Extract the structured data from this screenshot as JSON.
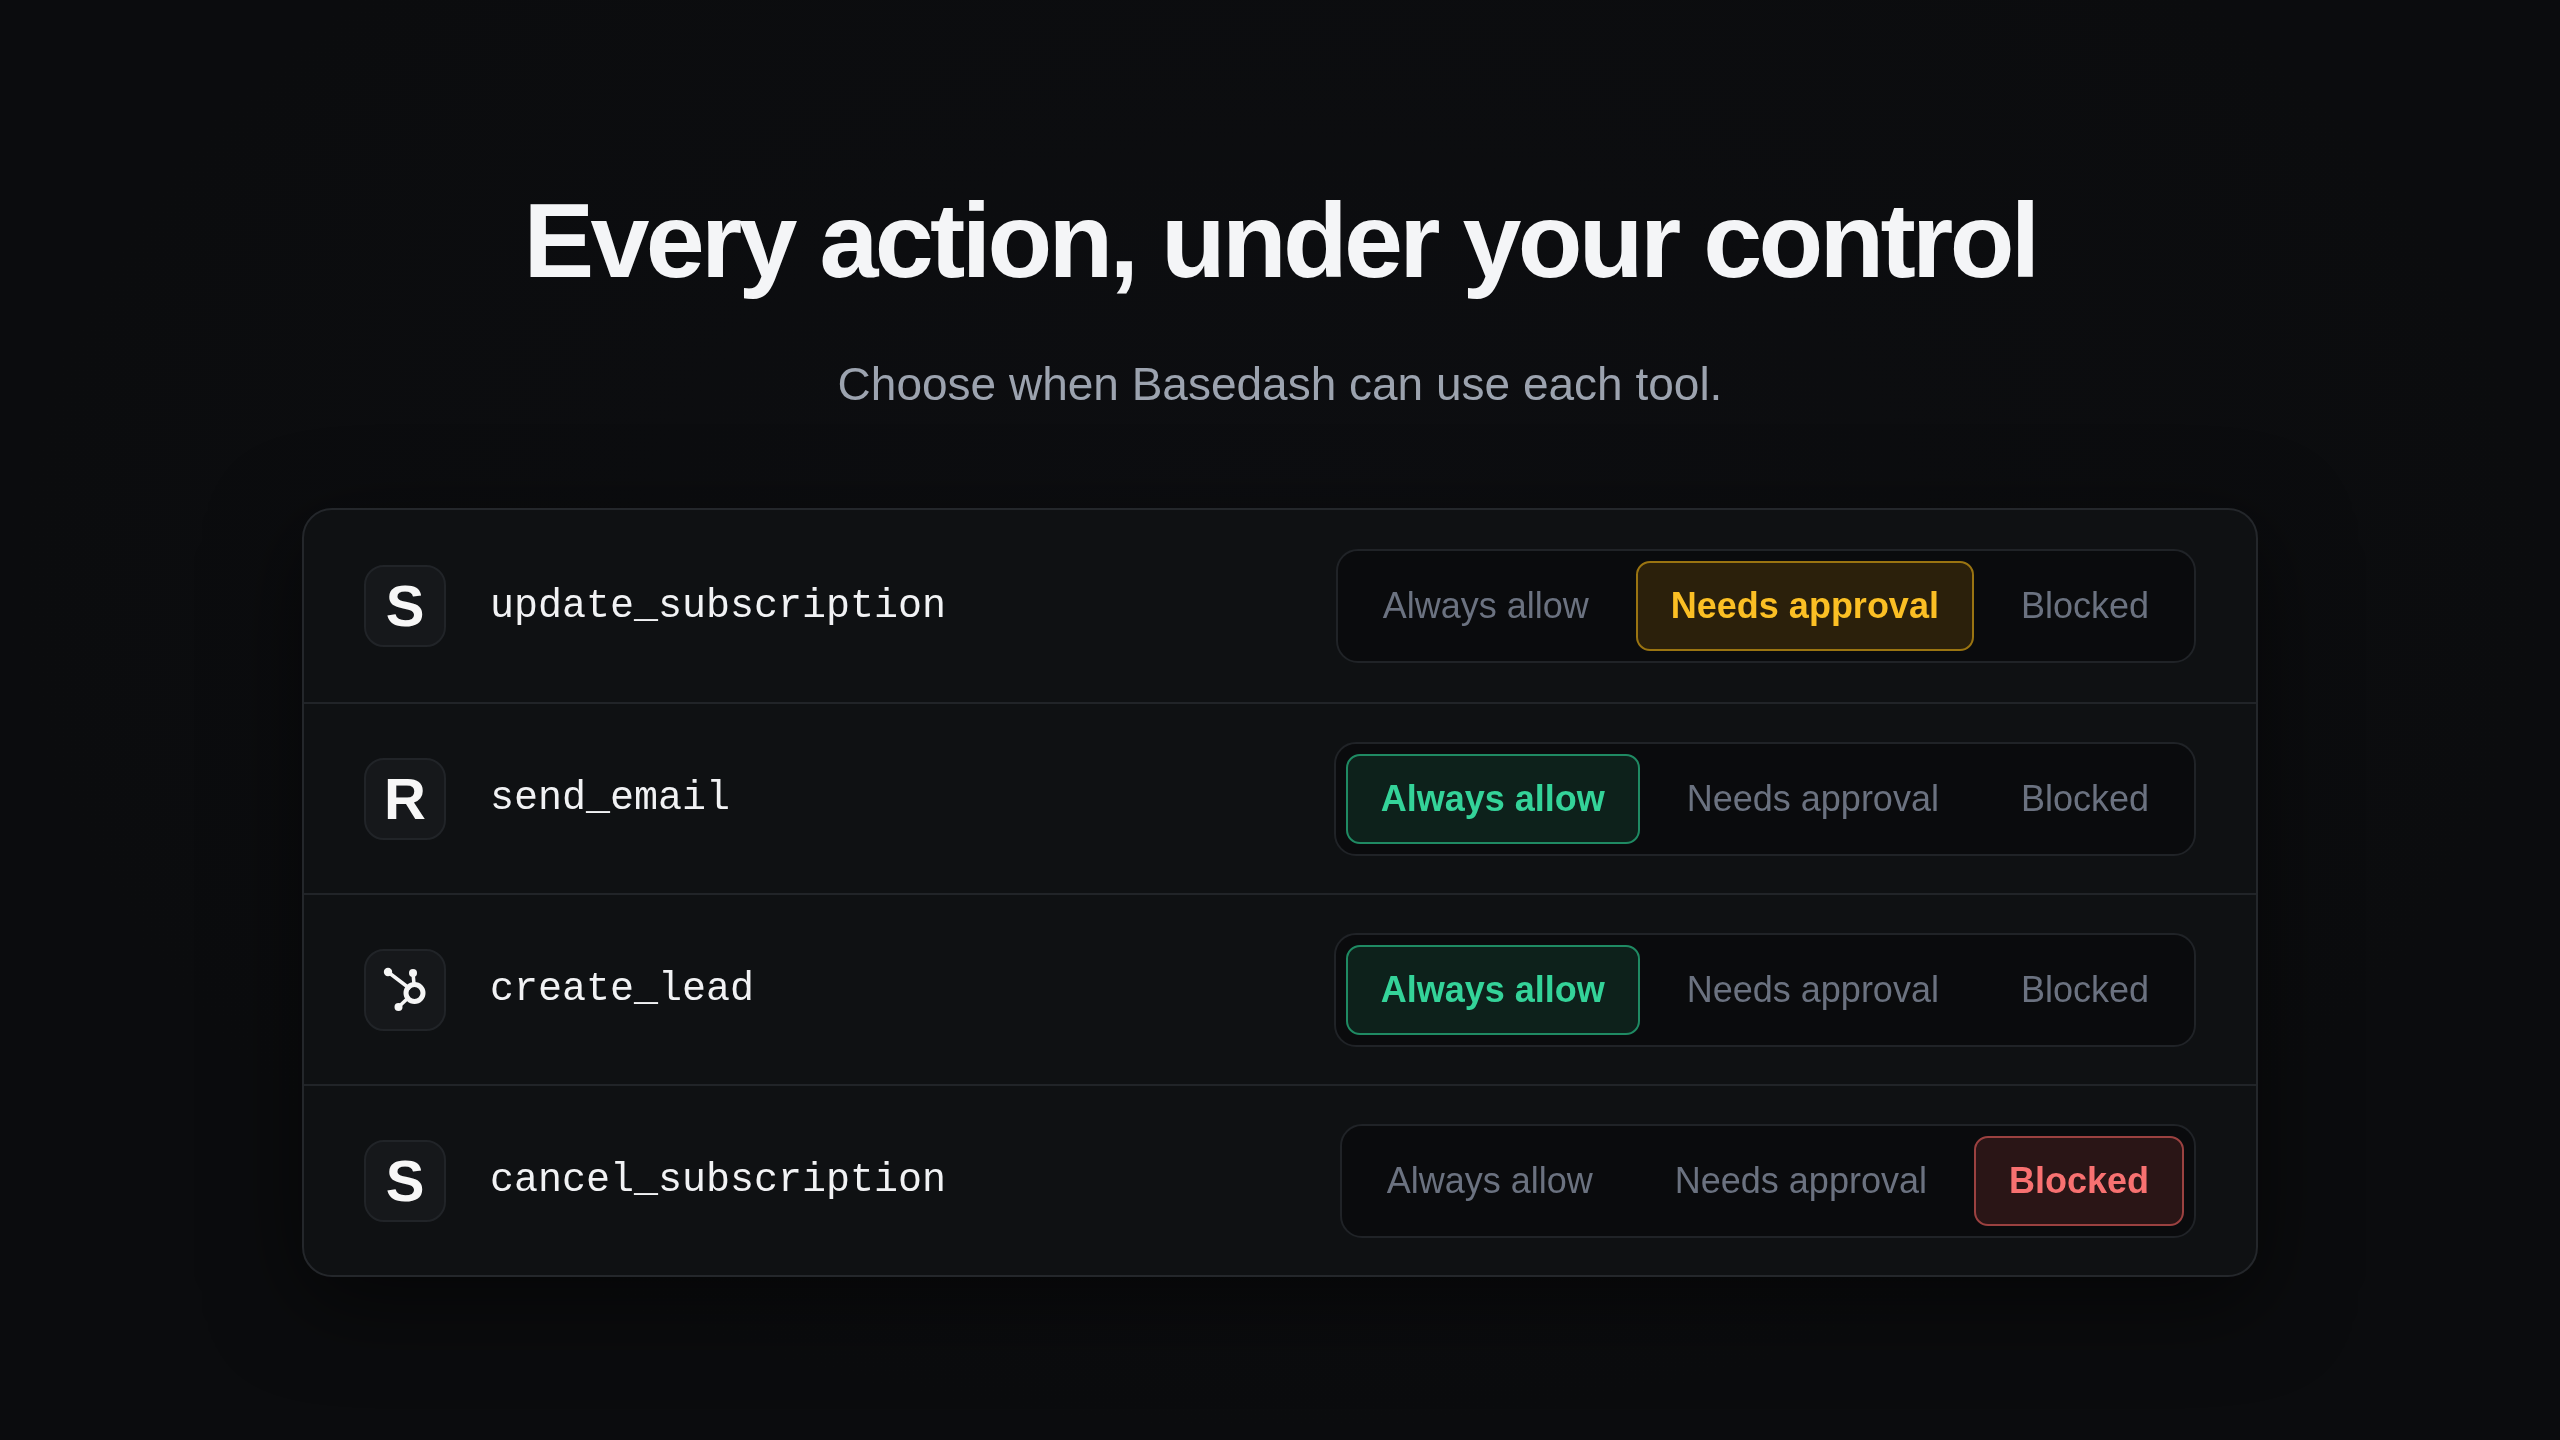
{
  "heading": {
    "title": "Every action, under your control",
    "subtitle": "Choose when Basedash can use each tool."
  },
  "tools": [
    {
      "name": "update_subscription",
      "icon": {
        "kind": "letter",
        "text": "S"
      },
      "options": [
        {
          "label": "Always allow",
          "kind": "allow",
          "selected": false
        },
        {
          "label": "Needs approval",
          "kind": "approval",
          "selected": true
        },
        {
          "label": "Blocked",
          "kind": "blocked",
          "selected": false
        }
      ]
    },
    {
      "name": "send_email",
      "icon": {
        "kind": "letter",
        "text": "R"
      },
      "options": [
        {
          "label": "Always allow",
          "kind": "allow",
          "selected": true
        },
        {
          "label": "Needs approval",
          "kind": "approval",
          "selected": false
        },
        {
          "label": "Blocked",
          "kind": "blocked",
          "selected": false
        }
      ]
    },
    {
      "name": "create_lead",
      "icon": {
        "kind": "hub"
      },
      "options": [
        {
          "label": "Always allow",
          "kind": "allow",
          "selected": true
        },
        {
          "label": "Needs approval",
          "kind": "approval",
          "selected": false
        },
        {
          "label": "Blocked",
          "kind": "blocked",
          "selected": false
        }
      ]
    },
    {
      "name": "cancel_subscription",
      "icon": {
        "kind": "letter",
        "text": "S"
      },
      "options": [
        {
          "label": "Always allow",
          "kind": "allow",
          "selected": false
        },
        {
          "label": "Needs approval",
          "kind": "approval",
          "selected": false
        },
        {
          "label": "Blocked",
          "kind": "blocked",
          "selected": true
        }
      ]
    }
  ]
}
